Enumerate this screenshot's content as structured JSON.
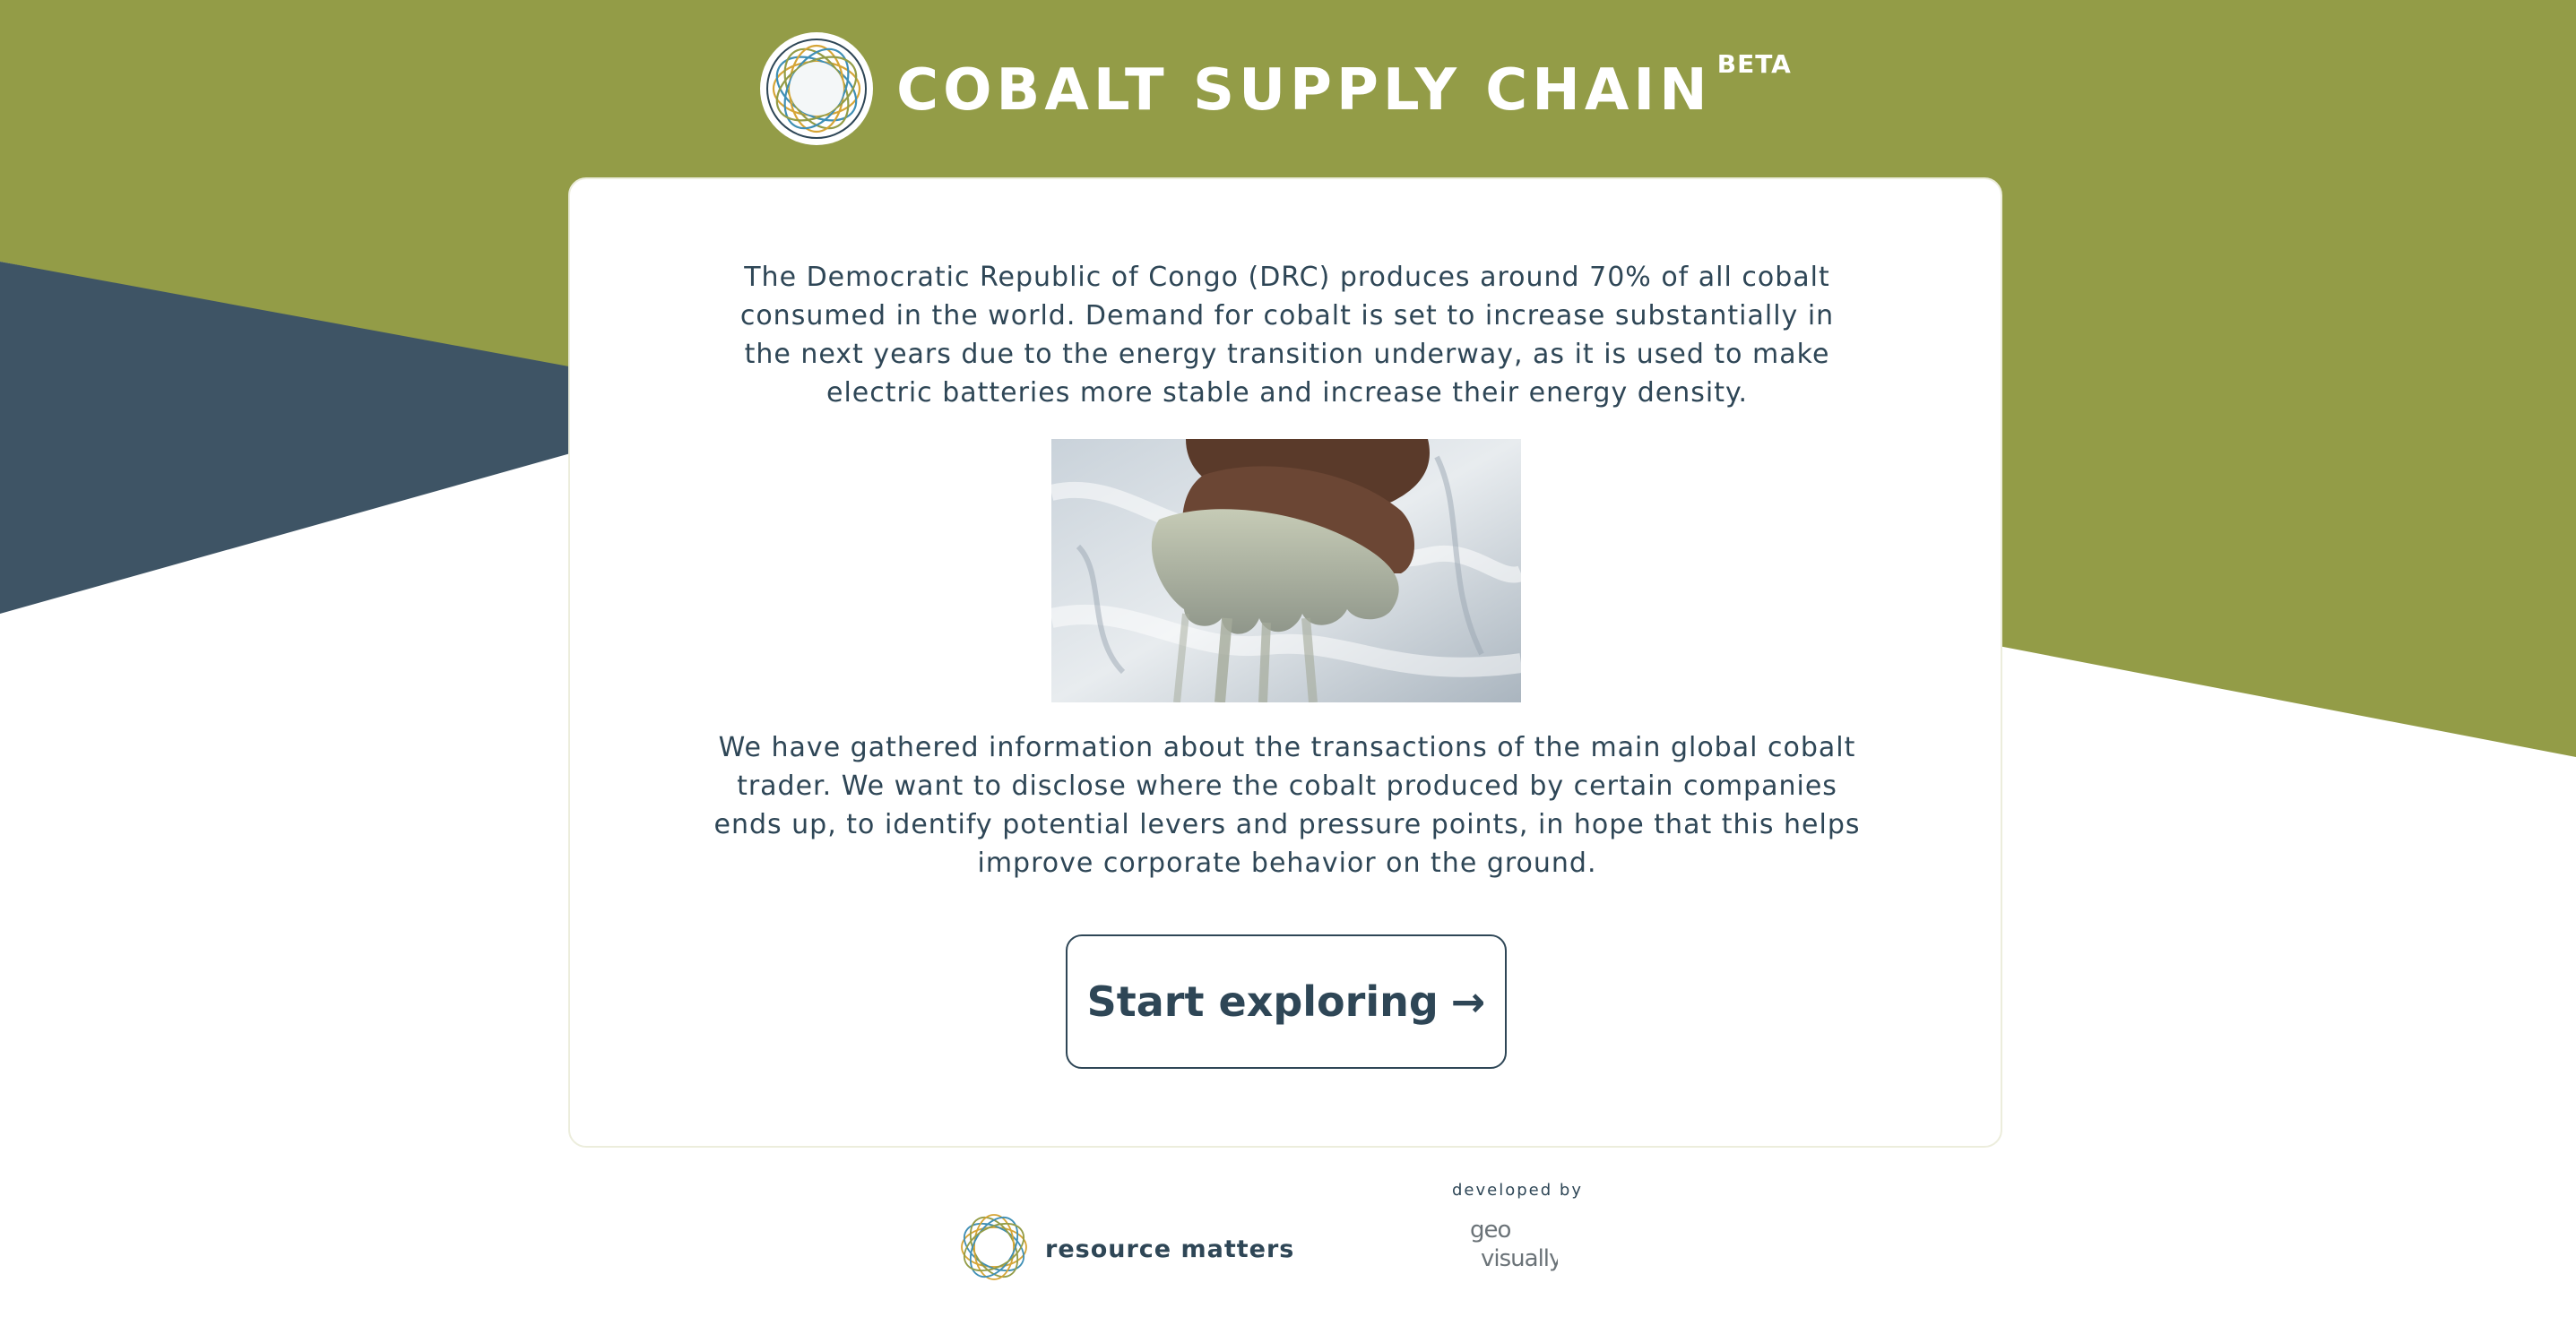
{
  "header": {
    "title": "COBALT SUPPLY CHAIN",
    "badge": "BETA",
    "logo_icon": "cobalt-ring-logo-icon"
  },
  "intro": {
    "paragraph_1": "The Democratic Republic of Congo (DRC) produces around 70% of all cobalt consumed in the world. Demand for cobalt is set to increase substantially in the next years due to the energy transition underway, as it is used to make electric batteries more stable and increase their energy density.",
    "paragraph_2": "We have gathered information about the transactions of the main global cobalt trader. We want to disclose where the cobalt produced by certain companies ends up, to identify potential levers and pressure points, in hope that this helps improve corporate behavior on the ground.",
    "photo_icon": "cobalt-ore-hand-photo"
  },
  "cta": {
    "label": "Start exploring",
    "arrow": "→"
  },
  "footer": {
    "partner_name": "resource matters",
    "partner_icon": "resource-matters-logo-icon",
    "developed_by_label": "developed by",
    "developer_logo_text": [
      "geo",
      "visually"
    ]
  },
  "colors": {
    "olive": "#939c47",
    "slate": "#3e5465",
    "text": "#2e4656",
    "card_border": "#eceddc"
  }
}
